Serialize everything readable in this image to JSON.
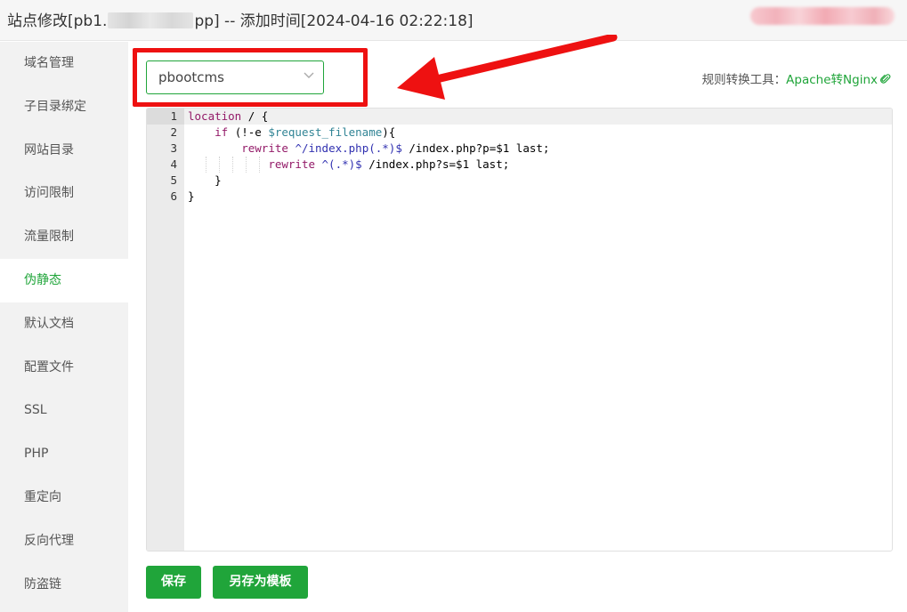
{
  "window": {
    "title_prefix": "站点修改[pb1.",
    "title_suffix": "pp] -- 添加时间[2024-04-16 02:22:18]"
  },
  "sidebar": {
    "items": [
      {
        "label": "域名管理"
      },
      {
        "label": "子目录绑定"
      },
      {
        "label": "网站目录"
      },
      {
        "label": "访问限制"
      },
      {
        "label": "流量限制"
      },
      {
        "label": "伪静态",
        "active": true
      },
      {
        "label": "默认文档"
      },
      {
        "label": "配置文件"
      },
      {
        "label": "SSL"
      },
      {
        "label": "PHP"
      },
      {
        "label": "重定向"
      },
      {
        "label": "反向代理"
      },
      {
        "label": "防盗链"
      }
    ]
  },
  "rewrite": {
    "template_select_value": "pbootcms",
    "tool_label": "规则转换工具：",
    "tool_link": "Apache转Nginx"
  },
  "editor": {
    "line_numbers": [
      "1",
      "2",
      "3",
      "4",
      "5",
      "6"
    ],
    "lines": [
      "location / {",
      "    if (!-e $request_filename){",
      "        rewrite ^/index.php(.*)$ /index.php?p=$1 last;",
      "            rewrite ^(.*)$ /index.php?s=$1 last;",
      "    }",
      "}"
    ]
  },
  "buttons": {
    "save": "保存",
    "save_as_template": "另存为模板"
  },
  "colors": {
    "accent": "#20a53a",
    "annotation_red": "#ee1111"
  }
}
